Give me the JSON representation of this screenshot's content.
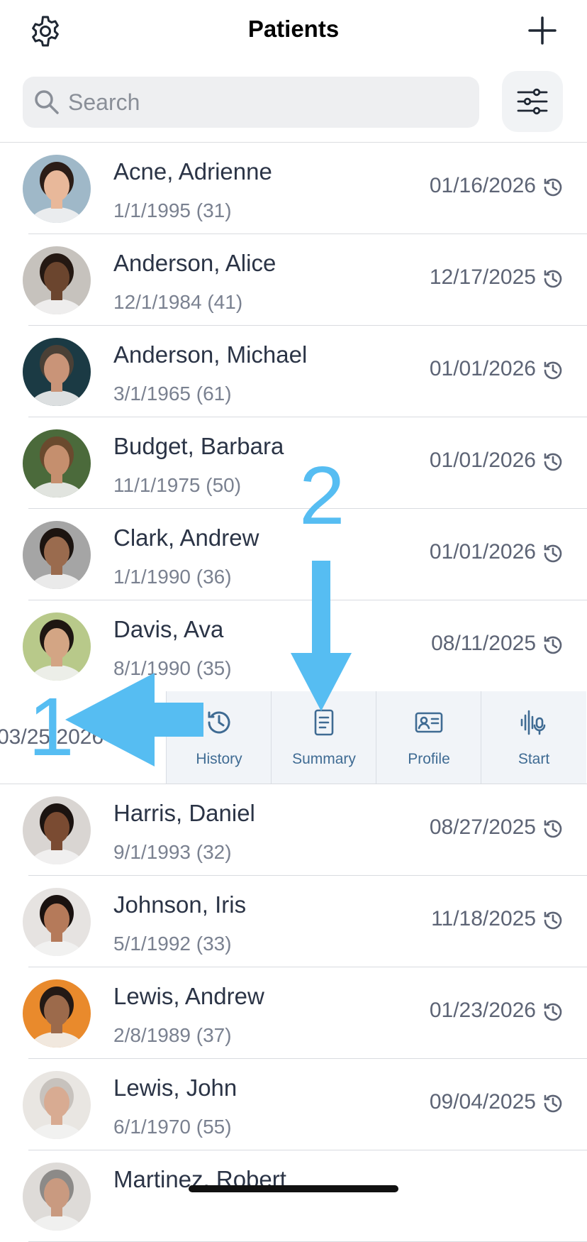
{
  "header": {
    "title": "Patients"
  },
  "search": {
    "placeholder": "Search"
  },
  "patients_top": [
    {
      "name": "Acne, Adrienne",
      "dob": "1/1/1995 (31)",
      "last_visit": "01/16/2026",
      "skin": "#e8b89a",
      "hair": "#2b1d17",
      "bg": "#9fb8c8"
    },
    {
      "name": "Anderson, Alice",
      "dob": "12/1/1984 (41)",
      "last_visit": "12/17/2025",
      "skin": "#6b452e",
      "hair": "#241812",
      "bg": "#c6c2bd"
    },
    {
      "name": "Anderson, Michael",
      "dob": "3/1/1965 (61)",
      "last_visit": "01/01/2026",
      "skin": "#c99478",
      "hair": "#4a4036",
      "bg": "#1b3a44"
    },
    {
      "name": "Budget, Barbara",
      "dob": "11/1/1975 (50)",
      "last_visit": "01/01/2026",
      "skin": "#c58f6e",
      "hair": "#6a4a2e",
      "bg": "#4b6a3b"
    },
    {
      "name": "Clark, Andrew",
      "dob": "1/1/1990 (36)",
      "last_visit": "01/01/2026",
      "skin": "#9a6b4e",
      "hair": "#1c1410",
      "bg": "#a5a5a5"
    },
    {
      "name": "Davis, Ava",
      "dob": "8/1/1990 (35)",
      "last_visit": "08/11/2025",
      "skin": "#d3a584",
      "hair": "#1e1612",
      "bg": "#b8c98a"
    }
  ],
  "swiped_row": {
    "last_visit": "03/25/2026",
    "actions": [
      {
        "label": "History",
        "icon": "history-icon"
      },
      {
        "label": "Summary",
        "icon": "document-icon"
      },
      {
        "label": "Profile",
        "icon": "id-card-icon"
      },
      {
        "label": "Start",
        "icon": "waveform-mic-icon"
      }
    ]
  },
  "patients_bottom": [
    {
      "name": "Harris, Daniel",
      "dob": "9/1/1993 (32)",
      "last_visit": "08/27/2025",
      "skin": "#7a4b32",
      "hair": "#1b1310",
      "bg": "#d9d5d2"
    },
    {
      "name": "Johnson, Iris",
      "dob": "5/1/1992 (33)",
      "last_visit": "11/18/2025",
      "skin": "#b57a5a",
      "hair": "#1a1210",
      "bg": "#e6e3e1"
    },
    {
      "name": "Lewis, Andrew",
      "dob": "2/8/1989 (37)",
      "last_visit": "01/23/2026",
      "skin": "#9c6a4b",
      "hair": "#231915",
      "bg": "#e98a2c"
    },
    {
      "name": "Lewis, John",
      "dob": "6/1/1970 (55)",
      "last_visit": "09/04/2025",
      "skin": "#d8ab92",
      "hair": "#c7c2bd",
      "bg": "#e9e6e2"
    },
    {
      "name": "Martinez, Robert",
      "dob": "",
      "last_visit": "",
      "skin": "#c99a80",
      "hair": "#8c8a88",
      "bg": "#dedbd8"
    }
  ],
  "annotations": {
    "step1": "1",
    "step2": "2"
  }
}
